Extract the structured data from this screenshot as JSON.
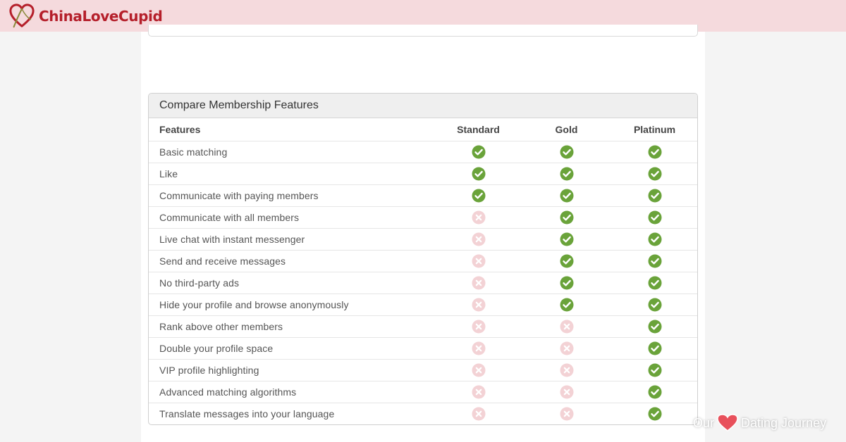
{
  "brand": {
    "name": "ChinaLoveCupid"
  },
  "comparison": {
    "title": "Compare Membership Features",
    "columns": [
      "Features",
      "Standard",
      "Gold",
      "Platinum"
    ],
    "rows": [
      {
        "feature": "Basic matching",
        "standard": true,
        "gold": true,
        "platinum": true
      },
      {
        "feature": "Like",
        "standard": true,
        "gold": true,
        "platinum": true
      },
      {
        "feature": "Communicate with paying members",
        "standard": true,
        "gold": true,
        "platinum": true
      },
      {
        "feature": "Communicate with all members",
        "standard": false,
        "gold": true,
        "platinum": true
      },
      {
        "feature": "Live chat with instant messenger",
        "standard": false,
        "gold": true,
        "platinum": true
      },
      {
        "feature": "Send and receive messages",
        "standard": false,
        "gold": true,
        "platinum": true
      },
      {
        "feature": "No third-party ads",
        "standard": false,
        "gold": true,
        "platinum": true
      },
      {
        "feature": "Hide your profile and browse anonymously",
        "standard": false,
        "gold": true,
        "platinum": true
      },
      {
        "feature": "Rank above other members",
        "standard": false,
        "gold": false,
        "platinum": true
      },
      {
        "feature": "Double your profile space",
        "standard": false,
        "gold": false,
        "platinum": true
      },
      {
        "feature": "VIP profile highlighting",
        "standard": false,
        "gold": false,
        "platinum": true
      },
      {
        "feature": "Advanced matching algorithms",
        "standard": false,
        "gold": false,
        "platinum": true
      },
      {
        "feature": "Translate messages into your language",
        "standard": false,
        "gold": false,
        "platinum": true
      }
    ]
  },
  "watermark": {
    "left": "Our",
    "right": "Dating Journey"
  },
  "icons": {
    "included": "check-circle-icon",
    "excluded": "x-circle-icon"
  },
  "colors": {
    "brand": "#b51f2a",
    "check": "#6aa33a",
    "cross": "#f3d2d5",
    "topbar": "#f5dadd"
  }
}
